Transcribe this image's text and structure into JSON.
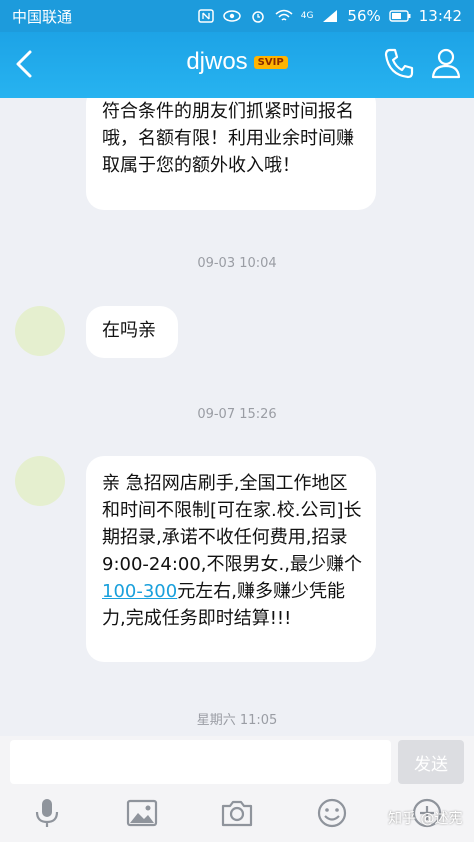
{
  "statusbar": {
    "carrier": "中国联通",
    "signal_label": "4G",
    "battery": "56%",
    "time": "13:42"
  },
  "header": {
    "title": "djwos",
    "badge": "SVIP",
    "back_icon": "chevron-left-icon",
    "phone_icon": "phone-icon",
    "profile_icon": "user-icon"
  },
  "messages": [
    {
      "text": "符合条件的朋友们抓紧时间报名哦，名额有限！利用业余时间赚取属于您的额外收入哦！"
    },
    {
      "timestamp": "09-03 10:04"
    },
    {
      "text": "在吗亲"
    },
    {
      "timestamp": "09-07 15:26"
    },
    {
      "text_before": "亲 急招网店刷手,全国工作地区和时间不限制[可在家.校.公司]长期招录,承诺不收任何费用,招录9:00-24:00,不限男女.,最少赚个",
      "link": "100-300",
      "text_after": "元左右,赚多赚少凭能力,完成任务即时结算!!!"
    },
    {
      "timestamp": "星期六 11:05"
    }
  ],
  "input": {
    "placeholder": "",
    "send_label": "发送"
  },
  "toolbar": {
    "icons": [
      "microphone-icon",
      "image-icon",
      "camera-icon",
      "emoji-icon",
      "plus-icon"
    ]
  },
  "watermark": "知乎 @述宪",
  "colors": {
    "header": "#1da3e6",
    "link": "#1aa0dc",
    "background": "#eef0f5",
    "avatar": "#e5efcf"
  }
}
